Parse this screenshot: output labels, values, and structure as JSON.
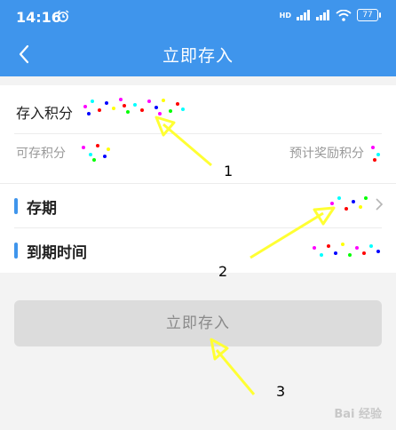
{
  "status_bar": {
    "time": "14:16",
    "network": "HD",
    "battery": "77"
  },
  "nav": {
    "title": "立即存入",
    "back_icon": "chevron-left-icon"
  },
  "deposit": {
    "points_label": "存入积分",
    "available_label": "可存积分",
    "expected_reward_label": "预计奖励积分"
  },
  "term": {
    "term_label": "存期",
    "expiry_label": "到期时间"
  },
  "submit_label": "立即存入",
  "annotations": [
    "1",
    "2",
    "3"
  ],
  "watermark": "Bai 经验",
  "colors": {
    "header": "#3f95ec",
    "accent": "#3f95ec",
    "button_bg": "#dcdcdc",
    "arrow": "#ffff33"
  }
}
